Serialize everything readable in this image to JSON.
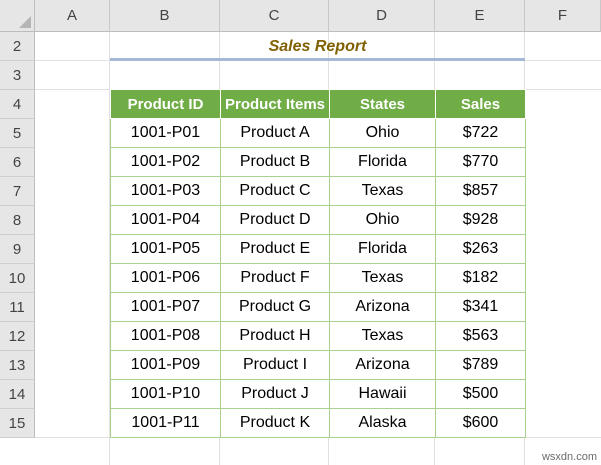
{
  "columns": [
    "A",
    "B",
    "C",
    "D",
    "E",
    "F"
  ],
  "rows": [
    "2",
    "3",
    "4",
    "5",
    "6",
    "7",
    "8",
    "9",
    "10",
    "11",
    "12",
    "13",
    "14",
    "15"
  ],
  "title": "Sales Report",
  "table": {
    "headers": [
      "Product ID",
      "Product Items",
      "States",
      "Sales"
    ],
    "rows": [
      [
        "1001-P01",
        "Product A",
        "Ohio",
        "$722"
      ],
      [
        "1001-P02",
        "Product B",
        "Florida",
        "$770"
      ],
      [
        "1001-P03",
        "Product C",
        "Texas",
        "$857"
      ],
      [
        "1001-P04",
        "Product D",
        "Ohio",
        "$928"
      ],
      [
        "1001-P05",
        "Product E",
        "Florida",
        "$263"
      ],
      [
        "1001-P06",
        "Product F",
        "Texas",
        "$182"
      ],
      [
        "1001-P07",
        "Product G",
        "Arizona",
        "$341"
      ],
      [
        "1001-P08",
        "Product H",
        "Texas",
        "$563"
      ],
      [
        "1001-P09",
        "Product I",
        "Arizona",
        "$789"
      ],
      [
        "1001-P10",
        "Product J",
        "Hawaii",
        "$500"
      ],
      [
        "1001-P11",
        "Product K",
        "Alaska",
        "$600"
      ]
    ]
  },
  "watermark": "wsxdn.com",
  "colors": {
    "header_fill": "#70ad47",
    "cell_border": "#a9d08e",
    "title_text": "#806000",
    "title_underline": "#a6b8d8",
    "sheet_header_bg": "#e6e6e6"
  }
}
